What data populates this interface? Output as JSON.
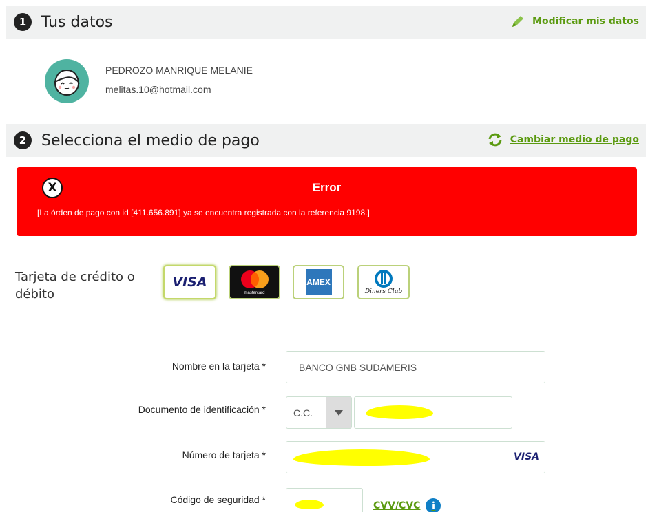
{
  "section1": {
    "step": "1",
    "title": "Tus datos",
    "link": "Modificar mis datos"
  },
  "user": {
    "name": "PEDROZO MANRIQUE MELANIE",
    "email": "melitas.10@hotmail.com"
  },
  "section2": {
    "step": "2",
    "title": "Selecciona el medio de pago",
    "link": "Cambiar medio de pago"
  },
  "error": {
    "icon": "X",
    "title": "Error",
    "message": "[La órden de pago con id [411.656.891] ya se encuentra registrada con la referencia 9198.]"
  },
  "payment": {
    "label": "Tarjeta de crédito o débito",
    "cards": [
      "VISA",
      "mastercard",
      "AMEX",
      "Diners Club"
    ]
  },
  "form": {
    "name_label": "Nombre en la tarjeta *",
    "name_value": "BANCO GNB SUDAMERIS",
    "doc_label": "Documento de identificación *",
    "doc_type": "C.C.",
    "card_number_label": "Número de tarjeta *",
    "card_brand": "VISA",
    "cvv_label": "Código de seguridad *",
    "cvv_link": "CVV/CVC",
    "info_icon": "i"
  },
  "colors": {
    "accent_green": "#5b9a10",
    "error_red": "#ff0000",
    "header_bg": "#f0f1f1",
    "avatar_teal": "#4fb3a1",
    "redaction_yellow": "#ffff00"
  }
}
